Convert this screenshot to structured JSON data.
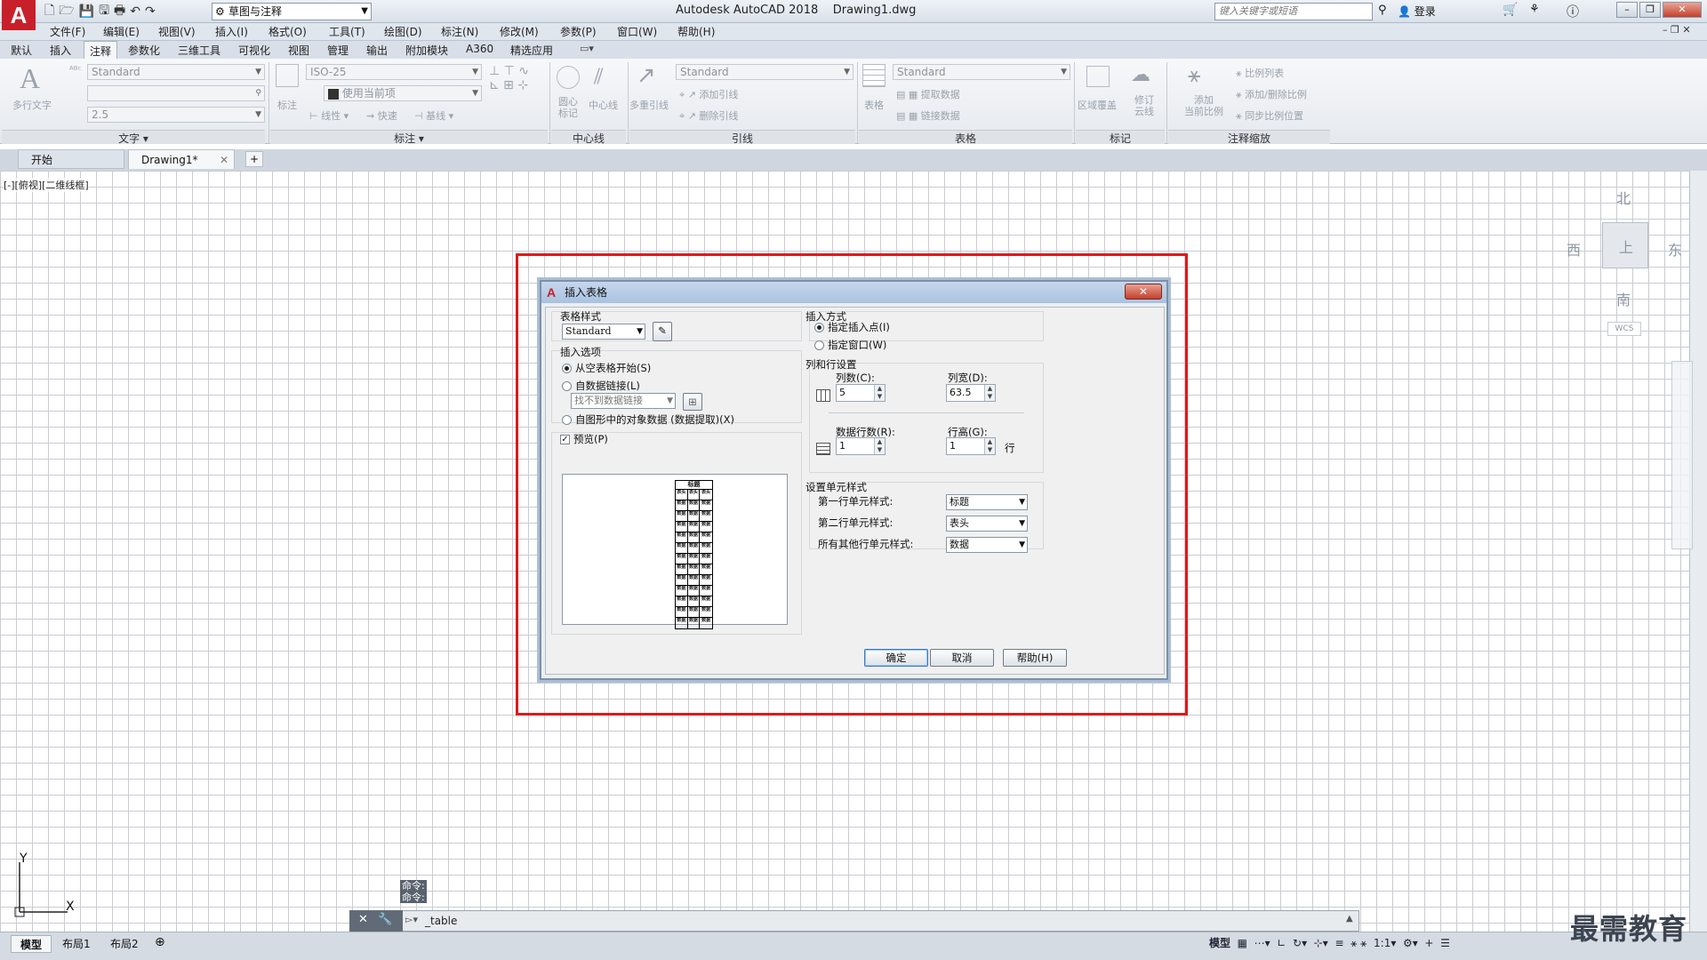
{
  "app": {
    "title": "Autodesk AutoCAD 2018",
    "file": "Drawing1.dwg",
    "logo": "A",
    "workspace": "草图与注释",
    "search_placeholder": "键入关键字或短语",
    "login": "登录"
  },
  "menu": [
    "文件(F)",
    "编辑(E)",
    "视图(V)",
    "插入(I)",
    "格式(O)",
    "工具(T)",
    "绘图(D)",
    "标注(N)",
    "修改(M)",
    "参数(P)",
    "窗口(W)",
    "帮助(H)"
  ],
  "ribbon_tabs": [
    "默认",
    "插入",
    "注释",
    "参数化",
    "三维工具",
    "可视化",
    "视图",
    "管理",
    "输出",
    "附加模块",
    "A360",
    "精选应用"
  ],
  "ribbon": {
    "text_panel": {
      "title": "文字",
      "mtext": "多行文字",
      "style": "Standard",
      "height": "2.5"
    },
    "dim_panel": {
      "title": "标注",
      "dim_label": "标注",
      "style": "ISO-25",
      "layer": "使用当前项",
      "linear": "线性",
      "quick": "快速",
      "baseline": "基线"
    },
    "centerline_panel": {
      "title": "中心线",
      "center_mark": "圆心\n标记",
      "centerline": "中心线"
    },
    "leader_panel": {
      "title": "引线",
      "multileader": "多重引线",
      "style": "Standard",
      "add": "添加引线",
      "remove": "删除引线"
    },
    "table_panel": {
      "title": "表格",
      "table": "表格",
      "style": "Standard",
      "extract": "提取数据",
      "link": "链接数据"
    },
    "mark_panel": {
      "title": "标记",
      "wipeout": "区域覆盖",
      "revcloud": "修订\n云线"
    },
    "scale_panel": {
      "title": "注释缩放",
      "add_scale": "添加\n当前比例",
      "scale_list": "比例列表",
      "add_del": "添加/删除比例",
      "sync": "同步比例位置"
    }
  },
  "file_tabs": [
    "开始",
    "Drawing1*"
  ],
  "viewport_label": "[-][俯视][二维线框]",
  "viewcube": {
    "north": "北",
    "south": "南",
    "east": "东",
    "west": "西",
    "top": "上",
    "wcs": "WCS"
  },
  "dialog": {
    "title": "插入表格",
    "close": "✕",
    "table_style_label": "表格样式",
    "table_style_value": "Standard",
    "insert_options_label": "插入选项",
    "opt_empty": "从空表格开始(S)",
    "opt_datalink": "自数据链接(L)",
    "datalink_value": "找不到数据链接",
    "opt_extract": "自图形中的对象数据 (数据提取)(X)",
    "preview_label": "预览(P)",
    "preview_caption": "标题",
    "preview_header": [
      "表头",
      "表头",
      "表头"
    ],
    "preview_cell": "数据",
    "insert_method_label": "插入方式",
    "method_point": "指定插入点(I)",
    "method_window": "指定窗口(W)",
    "colrow_label": "列和行设置",
    "cols_label": "列数(C):",
    "cols_value": "5",
    "colwidth_label": "列宽(D):",
    "colwidth_value": "63.5",
    "datarows_label": "数据行数(R):",
    "datarows_value": "1",
    "rowheight_label": "行高(G):",
    "rowheight_value": "1",
    "row_unit": "行",
    "cellstyle_label": "设置单元样式",
    "first_row_label": "第一行单元样式:",
    "first_row_value": "标题",
    "second_row_label": "第二行单元样式:",
    "second_row_value": "表头",
    "other_rows_label": "所有其他行单元样式:",
    "other_rows_value": "数据",
    "ok": "确定",
    "cancel": "取消",
    "help": "帮助(H)"
  },
  "command": {
    "history1": "命令:",
    "history2": "命令:",
    "input": "_table"
  },
  "layout_tabs": [
    "模型",
    "布局1",
    "布局2"
  ],
  "status": {
    "model": "模型",
    "scale": "1:1"
  },
  "watermark": "最需教育",
  "ucs": {
    "x": "X",
    "y": "Y"
  },
  "colors": {
    "accent": "#c8202a",
    "highlight_box": "#e01818",
    "dialog_border": "#7f90a6"
  }
}
